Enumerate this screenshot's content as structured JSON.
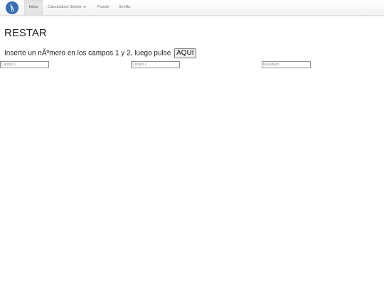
{
  "navbar": {
    "logo_icon": "logo-icon",
    "items": [
      {
        "label": "Inicio",
        "active": true
      },
      {
        "label": "Calculadora Simple",
        "has_dropdown": true
      },
      {
        "label": "Puzzle"
      },
      {
        "label": "Sevilla"
      }
    ]
  },
  "main": {
    "title": "RESTAR",
    "instruction_text": "Inserte un nÃºmero en los campos 1 y 2, luego pulse",
    "button_label": "AQUI",
    "fields": {
      "campo1_placeholder": "Campo 1",
      "campo2_placeholder": "Campo 2",
      "resultado_placeholder": "Resultado"
    }
  },
  "colors": {
    "brand": "#3a6fb5",
    "navbar_active_bg": "#e5e5e5",
    "nav_text": "#777777"
  }
}
